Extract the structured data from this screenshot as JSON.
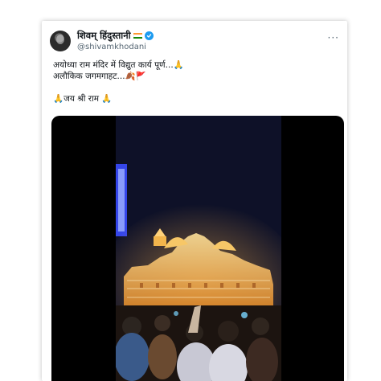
{
  "post": {
    "author": {
      "display_name": "शिवम् हिंदुस्तानी",
      "flag_icon": "india-flag-icon",
      "verified_icon": "verified-badge-icon",
      "handle": "@shivamkhodani"
    },
    "more_icon": "more-options-icon",
    "more_label": "···",
    "text_lines": [
      "अयोध्या राम मंदिर में विद्युत कार्य पूर्ण...🙏",
      "अलौकिक जगमगाहट...🍂🚩",
      "",
      "🙏जय श्री राम 🙏"
    ]
  },
  "media": {
    "type": "video",
    "subject": "temple-night-illumination-video"
  },
  "colors": {
    "verified": "#1d9bf0",
    "text": "#0f1419",
    "secondary_text": "#536471",
    "media_background": "#000000",
    "temple_glow": "#f5b04a"
  }
}
